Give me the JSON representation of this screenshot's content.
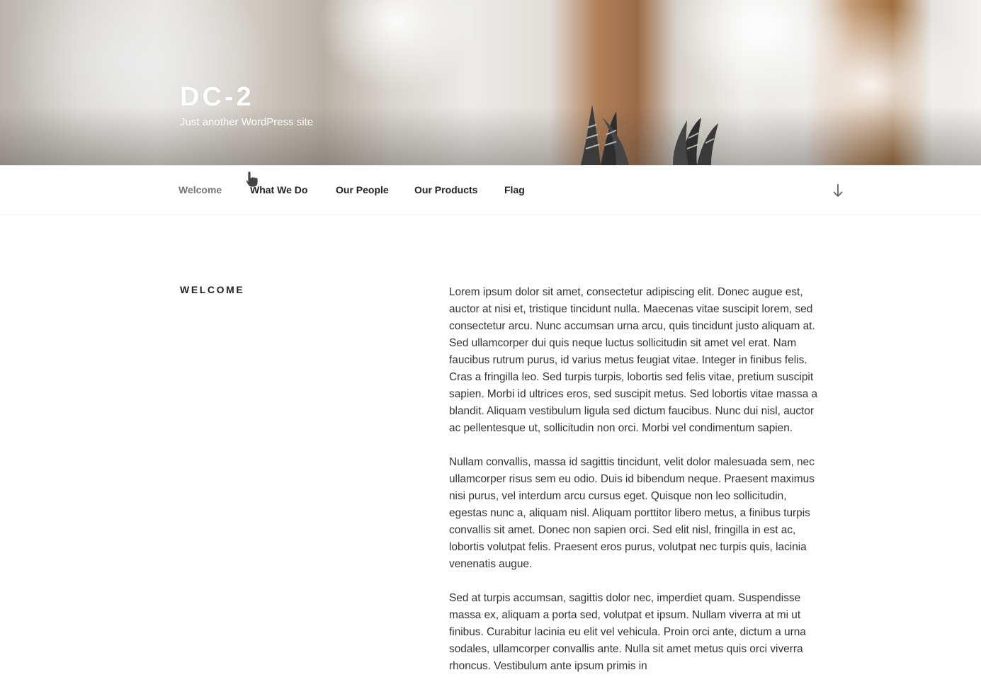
{
  "site": {
    "title": "DC-2",
    "tagline": "Just another WordPress site"
  },
  "nav": {
    "items": [
      {
        "label": "Welcome",
        "current": true
      },
      {
        "label": "What We Do",
        "current": false
      },
      {
        "label": "Our People",
        "current": false
      },
      {
        "label": "Our Products",
        "current": false
      },
      {
        "label": "Flag",
        "current": false
      }
    ],
    "scroll_icon": "arrow-down-icon"
  },
  "page": {
    "title": "Welcome",
    "paragraphs": [
      "Lorem ipsum dolor sit amet, consectetur adipiscing elit. Donec augue est, auctor at nisi et, tristique tincidunt nulla. Maecenas vitae suscipit lorem, sed consectetur arcu. Nunc accumsan urna arcu, quis tincidunt justo aliquam at. Sed ullamcorper dui quis neque luctus sollicitudin sit amet vel erat. Nam faucibus rutrum purus, id varius metus feugiat vitae. Integer in finibus felis. Cras a fringilla leo. Sed turpis turpis, lobortis sed felis vitae, pretium suscipit sapien. Morbi id ultrices eros, sed suscipit metus. Sed lobortis vitae massa a blandit. Aliquam vestibulum ligula sed dictum faucibus. Nunc dui nisl, auctor ac pellentesque ut, sollicitudin non orci. Morbi vel condimentum sapien.",
      "Nullam convallis, massa id sagittis tincidunt, velit dolor malesuada sem, nec ullamcorper risus sem eu odio. Duis id bibendum neque. Praesent maximus nisi purus, vel interdum arcu cursus eget. Quisque non leo sollicitudin, egestas nunc a, aliquam nisl. Aliquam porttitor libero metus, a finibus turpis convallis sit amet. Donec non sapien orci. Sed elit nisl, fringilla in est ac, lobortis volutpat felis. Praesent eros purus, volutpat nec turpis quis, lacinia venenatis augue.",
      "Sed at turpis accumsan, sagittis dolor nec, imperdiet quam. Suspendisse massa ex, aliquam a porta sed, volutpat et ipsum. Nullam viverra at mi ut finibus. Curabitur lacinia eu elit vel vehicula. Proin orci ante, dictum a urna sodales, ullamcorper convallis ante. Nulla sit amet metus quis orci viverra rhoncus. Vestibulum ante ipsum primis in"
    ]
  },
  "colors": {
    "accent_text": "#222222",
    "muted_text": "#767676",
    "body_text": "#333333"
  }
}
